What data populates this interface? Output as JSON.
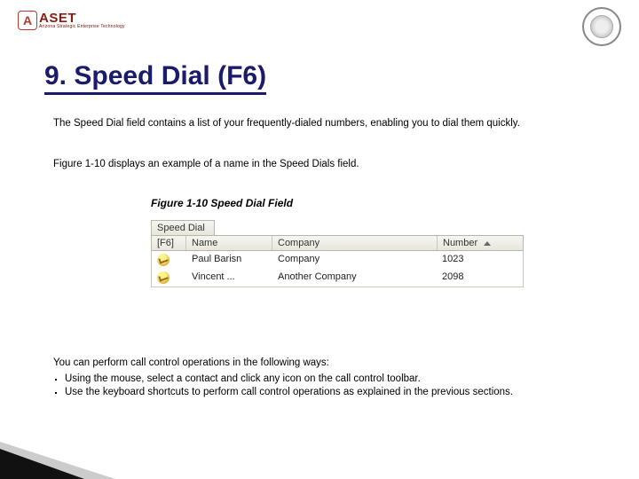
{
  "branding": {
    "logo_letter": "A",
    "logo_word": "ASET",
    "logo_sub": "Arizona Strategic Enterprise Technology"
  },
  "heading": "9. Speed Dial (F6)",
  "paragraphs": {
    "intro": "The Speed Dial field contains a list of your frequently-dialed numbers, enabling you to dial them quickly.",
    "figref": "Figure 1-10 displays an example of a name in the Speed Dials field.",
    "ops_intro": "You can perform call control operations in the following ways:"
  },
  "figure": {
    "caption": "Figure 1-10 Speed Dial Field",
    "panel_title": "Speed Dial",
    "columns": {
      "shortcut": "[F6]",
      "name": "Name",
      "company": "Company",
      "number": "Number"
    },
    "rows": [
      {
        "name": "Paul Barisn",
        "company": "Company",
        "number": "1023"
      },
      {
        "name": "Vincent ...",
        "company": "Another Company",
        "number": "2098"
      }
    ]
  },
  "bullets": [
    "Using the mouse, select a contact and click any icon on the call control toolbar.",
    "Use the keyboard shortcuts to perform call control operations as explained in the previous sections."
  ]
}
